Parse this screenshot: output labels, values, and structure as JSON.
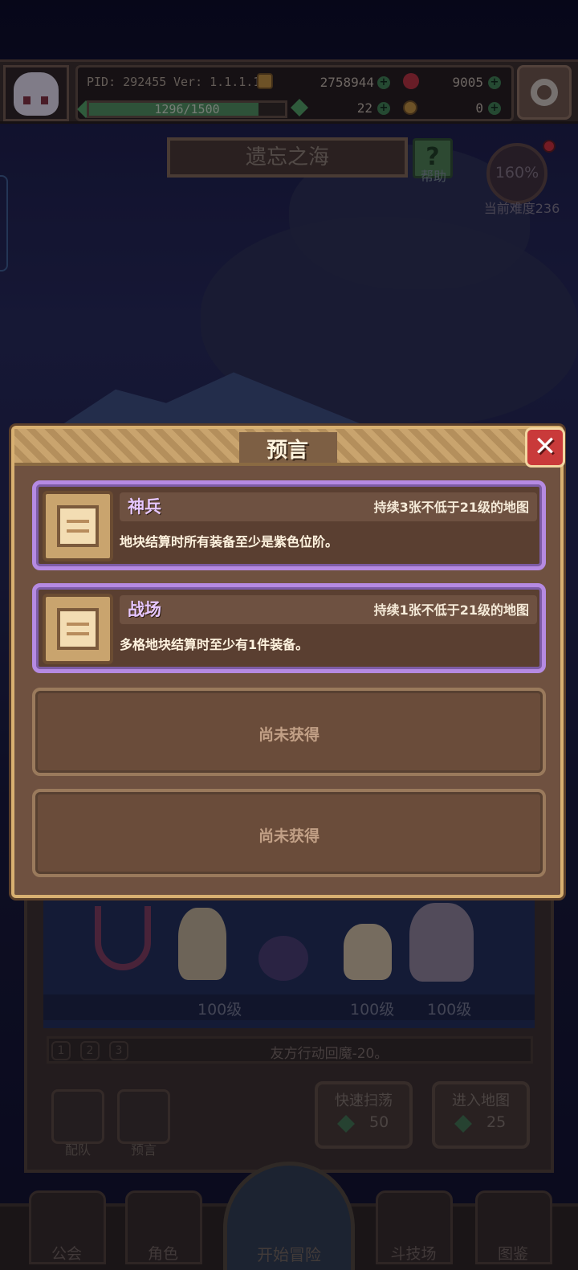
{
  "hud": {
    "pid": "PID: 292455",
    "version": "Ver: 1.1.1.12",
    "gold": "2758944",
    "red_gems": "9005",
    "energy_text": "1296/1500",
    "energy_fraction": 0.864,
    "clovers": "22",
    "keys": "0"
  },
  "area": {
    "title": "遗忘之海",
    "help_label": "帮助",
    "difficulty_percent": "160%",
    "difficulty_label": "当前难度236"
  },
  "modal": {
    "title": "预言",
    "close_glyph": "✕",
    "cards": [
      {
        "name": "神兵",
        "duration": "持续3张不低于21级的地图",
        "description": "地块结算时所有装备至少是紫色位阶。"
      },
      {
        "name": "战场",
        "duration": "持续1张不低于21级的地图",
        "description": "多格地块结算时至少有1件装备。"
      }
    ],
    "empty_slots": [
      "尚未获得",
      "尚未获得"
    ]
  },
  "battle": {
    "levels": [
      "100级",
      "100级",
      "100级"
    ],
    "skill_tabs": [
      "1",
      "2",
      "3"
    ],
    "skill_description": "友方行动回魔-20。"
  },
  "actions": {
    "team_label": "配队",
    "prophecy_label": "预言",
    "sweep_title": "快速扫荡",
    "sweep_cost": "50",
    "enter_title": "进入地图",
    "enter_cost": "25"
  },
  "nav": {
    "items": [
      "公会",
      "角色",
      "开始冒险",
      "斗技场",
      "图鉴"
    ]
  },
  "colors": {
    "modal_bg": "#6f5140",
    "card_border": "#b58ae2",
    "card_name": "#e6c6ff",
    "close_red": "#c93a3a",
    "gold_trim": "#d8b071"
  },
  "icons": [
    "avatar",
    "gold-coin-icon",
    "red-gem-icon",
    "clover-icon",
    "key-icon",
    "gear-icon",
    "help-icon",
    "scroll-icon",
    "close-icon",
    "magnify-icon",
    "sword-icon"
  ]
}
